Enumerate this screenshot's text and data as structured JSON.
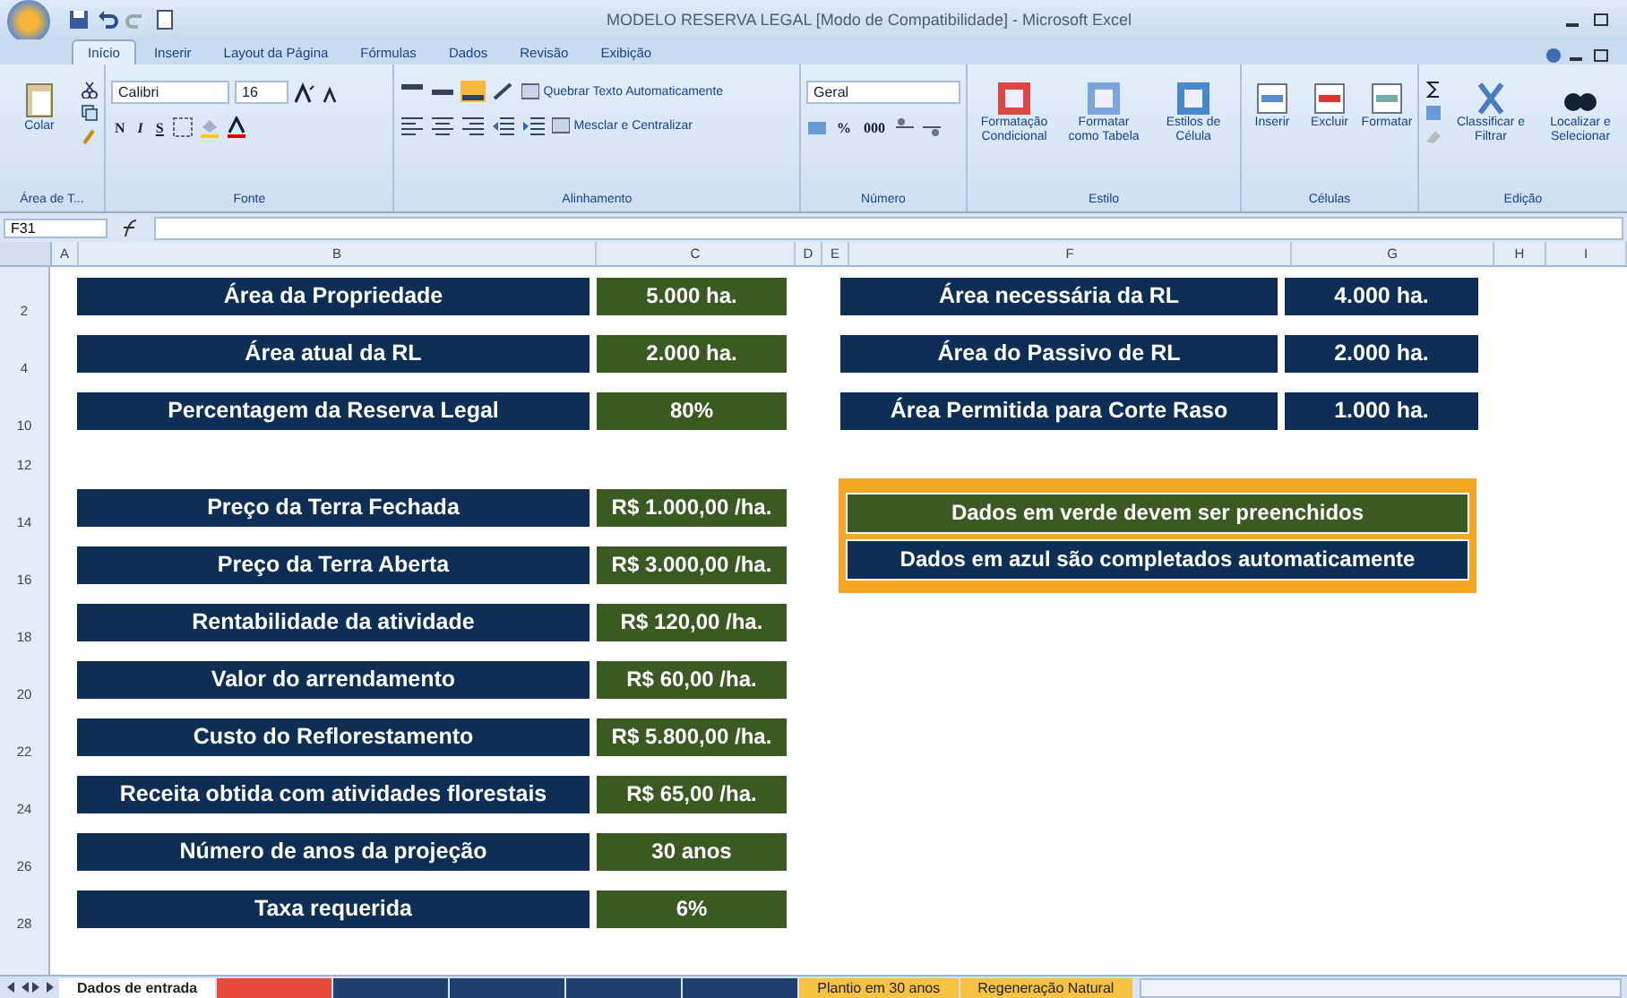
{
  "window": {
    "title": "MODELO RESERVA LEGAL  [Modo de Compatibilidade] - Microsoft Excel"
  },
  "ribbon_tabs": [
    {
      "label": "Início",
      "selected": true
    },
    {
      "label": "Inserir",
      "selected": false
    },
    {
      "label": "Layout da Página",
      "selected": false
    },
    {
      "label": "Fórmulas",
      "selected": false
    },
    {
      "label": "Dados",
      "selected": false
    },
    {
      "label": "Revisão",
      "selected": false
    },
    {
      "label": "Exibição",
      "selected": false
    }
  ],
  "ribbon": {
    "paste": "Colar",
    "font_name": "Calibri",
    "font_size": "16",
    "bold": "N",
    "italic": "I",
    "underline": "S",
    "wrap_text": "Quebrar Texto Automaticamente",
    "merge": "Mesclar e Centralizar",
    "number_format": "Geral",
    "percent": "%",
    "thousands": "000",
    "style_buttons": [
      "Formatação Condicional",
      "Formatar como Tabela",
      "Estilos de Célula"
    ],
    "cell_buttons": [
      "Inserir",
      "Excluir",
      "Formatar"
    ],
    "edit_buttons": [
      "Classificar e Filtrar",
      "Localizar e Selecionar"
    ],
    "groups": [
      "Área de T...",
      "Fonte",
      "Alinhamento",
      "Número",
      "Estilo",
      "Células",
      "Edição"
    ]
  },
  "formula_bar": {
    "name_box": "F31"
  },
  "columns": [
    "A",
    "B",
    "C",
    "D",
    "E",
    "F",
    "G",
    "H",
    "I"
  ],
  "rows": [
    {
      "number": "2",
      "left": {
        "label": "Área da Propriedade",
        "value": "5.000 ha.",
        "kind": "input"
      },
      "right": {
        "label": "Área necessária da RL",
        "value": "4.000 ha.",
        "kind": "computed"
      }
    },
    {
      "number": "4",
      "left": {
        "label": "Área atual da RL",
        "value": "2.000 ha.",
        "kind": "input"
      },
      "right": {
        "label": "Área do Passivo de RL",
        "value": "2.000 ha.",
        "kind": "computed"
      }
    },
    {
      "number": "10",
      "left": {
        "label": "Percentagem da Reserva Legal",
        "value": "80%",
        "kind": "input"
      },
      "right": {
        "label": "Área Permitida para Corte Raso",
        "value": "1.000 ha.",
        "kind": "computed"
      }
    },
    {
      "number": "12"
    },
    {
      "number": "14",
      "left": {
        "label": "Preço da Terra Fechada",
        "value": "R$ 1.000,00 /ha.",
        "kind": "input"
      },
      "legend": {
        "text": "Dados em verde devem ser preenchidos",
        "kind": "input"
      }
    },
    {
      "number": "16",
      "left": {
        "label": "Preço da Terra Aberta",
        "value": "R$ 3.000,00 /ha.",
        "kind": "input"
      },
      "legend": {
        "text": "Dados em azul são completados automaticamente",
        "kind": "computed"
      }
    },
    {
      "number": "18",
      "left": {
        "label": "Rentabilidade da atividade",
        "value": "R$ 120,00 /ha.",
        "kind": "input"
      }
    },
    {
      "number": "20",
      "left": {
        "label": "Valor do arrendamento",
        "value": "R$ 60,00 /ha.",
        "kind": "input"
      }
    },
    {
      "number": "22",
      "left": {
        "label": "Custo do Reflorestamento",
        "value": "R$ 5.800,00 /ha.",
        "kind": "input"
      }
    },
    {
      "number": "24",
      "left": {
        "label": "Receita obtida com atividades florestais",
        "value": "R$ 65,00 /ha.",
        "kind": "input"
      }
    },
    {
      "number": "26",
      "left": {
        "label": "Número de anos da projeção",
        "value": "30 anos",
        "kind": "input"
      }
    },
    {
      "number": "28",
      "left": {
        "label": "Taxa requerida",
        "value": "6%",
        "kind": "input"
      }
    }
  ],
  "sheet_tabs": [
    {
      "label": "Dados de entrada",
      "selected": true,
      "color": "#ffffff"
    },
    {
      "color": "#e84a3c",
      "selected": false
    },
    {
      "color": "#1f3f6e",
      "selected": false
    },
    {
      "color": "#1f3f6e",
      "selected": false
    },
    {
      "color": "#1f3f6e",
      "selected": false
    },
    {
      "color": "#1f3f6e",
      "selected": false
    },
    {
      "label": "Plantio em 30 anos",
      "selected": false,
      "color": "#f5c242"
    },
    {
      "label": "Regeneração Natural",
      "selected": false,
      "color": "#f5c242"
    }
  ]
}
